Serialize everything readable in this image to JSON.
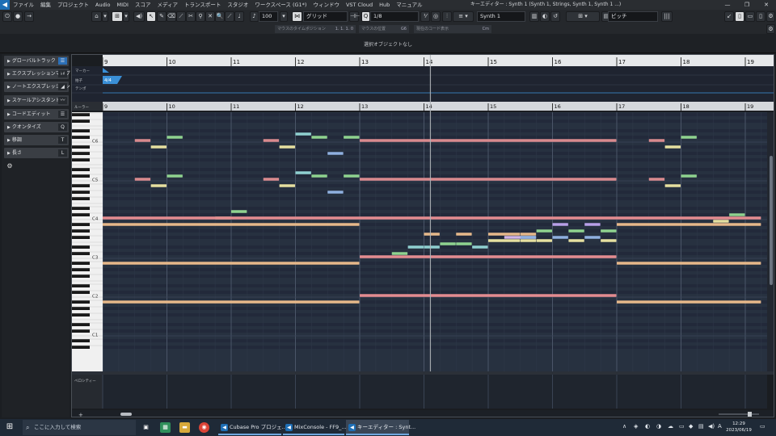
{
  "menubar": {
    "items": [
      "ファイル",
      "編集",
      "プロジェクト",
      "Audio",
      "MIDI",
      "スコア",
      "メディア",
      "トランスポート",
      "スタジオ",
      "ワークスペース (G1*)",
      "ウィンドウ",
      "VST Cloud",
      "Hub",
      "マニュアル"
    ],
    "window_title": "キーエディター : Synth 1 (Synth 1, Strings, Synth 1, Synth 1 ...)",
    "controls": [
      "—",
      "❐",
      "✕"
    ]
  },
  "toolbar": {
    "velocity_value": "100",
    "snap_mode": "グリッド",
    "quantize_value": "1/8",
    "instrument": "Synth 1",
    "note_expression_param": "ピッチ"
  },
  "infoline": {
    "fields": [
      {
        "label": "マウスのタイムポジション",
        "value": "1. 1. 1.  0"
      },
      {
        "label": "マウスの位置",
        "value": "G6"
      },
      {
        "label": "現在のコード表示",
        "value": "Cm"
      }
    ]
  },
  "status": {
    "message": "選択オブジェクトなし"
  },
  "inspector": {
    "sections": [
      {
        "label": "グローバルトラック",
        "icon": "☰"
      },
      {
        "label": "エクスプレッションマップ",
        "icon": "♭♯"
      },
      {
        "label": "ノートエクスプレッション",
        "icon": "◢"
      },
      {
        "label": "スケールアシスタント",
        "icon": "〰"
      },
      {
        "label": "コードエディット",
        "icon": "☰"
      },
      {
        "label": "クオンタイズ",
        "icon": "Q"
      },
      {
        "label": "移調",
        "icon": "T"
      },
      {
        "label": "長さ",
        "icon": "L"
      }
    ]
  },
  "editor": {
    "bars": [
      "9",
      "10",
      "11",
      "12",
      "13",
      "14",
      "15",
      "16",
      "17",
      "18",
      "19"
    ],
    "global_tracks": [
      "マーカー",
      "拍子",
      "テンポ"
    ],
    "ruler_label": "ルーラー",
    "time_signature": "4/4",
    "octave_labels": [
      "C6",
      "C5",
      "C4",
      "C3",
      "C2",
      "C1"
    ],
    "controller_lane_label": "ベロシティー",
    "notes": [
      {
        "bar": 9.5,
        "len": 0.25,
        "pitch": 84,
        "color": "#d98a8e"
      },
      {
        "bar": 9.75,
        "len": 0.25,
        "pitch": 82,
        "color": "#e6e0a0"
      },
      {
        "bar": 10.0,
        "len": 0.25,
        "pitch": 85,
        "color": "#8fd38f"
      },
      {
        "bar": 9.5,
        "len": 0.25,
        "pitch": 72,
        "color": "#d98a8e"
      },
      {
        "bar": 9.75,
        "len": 0.25,
        "pitch": 70,
        "color": "#e6e0a0"
      },
      {
        "bar": 10.0,
        "len": 0.25,
        "pitch": 73,
        "color": "#8fd38f"
      },
      {
        "bar": 11.0,
        "len": 0.25,
        "pitch": 62,
        "color": "#8fd38f"
      },
      {
        "bar": 10.75,
        "len": 0.25,
        "pitch": 60,
        "color": "#e6e0a0"
      },
      {
        "bar": 11.5,
        "len": 0.25,
        "pitch": 84,
        "color": "#d98a8e"
      },
      {
        "bar": 11.75,
        "len": 0.25,
        "pitch": 82,
        "color": "#e6e0a0"
      },
      {
        "bar": 12.0,
        "len": 0.25,
        "pitch": 86,
        "color": "#8fd0d0"
      },
      {
        "bar": 12.25,
        "len": 0.25,
        "pitch": 85,
        "color": "#8fd38f"
      },
      {
        "bar": 12.5,
        "len": 0.25,
        "pitch": 80,
        "color": "#8fb0e0"
      },
      {
        "bar": 12.75,
        "len": 0.25,
        "pitch": 85,
        "color": "#8fd38f"
      },
      {
        "bar": 11.5,
        "len": 0.25,
        "pitch": 72,
        "color": "#d98a8e"
      },
      {
        "bar": 11.75,
        "len": 0.25,
        "pitch": 70,
        "color": "#e6e0a0"
      },
      {
        "bar": 12.0,
        "len": 0.25,
        "pitch": 74,
        "color": "#8fd0d0"
      },
      {
        "bar": 12.25,
        "len": 0.25,
        "pitch": 73,
        "color": "#8fd38f"
      },
      {
        "bar": 12.5,
        "len": 0.25,
        "pitch": 68,
        "color": "#8fb0e0"
      },
      {
        "bar": 12.75,
        "len": 0.25,
        "pitch": 73,
        "color": "#8fd38f"
      },
      {
        "bar": 13.0,
        "len": 4.0,
        "pitch": 84,
        "color": "#d98a8e"
      },
      {
        "bar": 13.0,
        "len": 4.0,
        "pitch": 72,
        "color": "#d98a8e"
      },
      {
        "bar": 17.5,
        "len": 0.25,
        "pitch": 84,
        "color": "#d98a8e"
      },
      {
        "bar": 17.75,
        "len": 0.25,
        "pitch": 82,
        "color": "#e6e0a0"
      },
      {
        "bar": 18.0,
        "len": 0.25,
        "pitch": 85,
        "color": "#8fd38f"
      },
      {
        "bar": 17.5,
        "len": 0.25,
        "pitch": 72,
        "color": "#d98a8e"
      },
      {
        "bar": 17.75,
        "len": 0.25,
        "pitch": 70,
        "color": "#e6e0a0"
      },
      {
        "bar": 18.0,
        "len": 0.25,
        "pitch": 73,
        "color": "#8fd38f"
      },
      {
        "bar": 9.0,
        "len": 10.25,
        "pitch": 60,
        "color": "#e38c90"
      },
      {
        "bar": 9.0,
        "len": 4.0,
        "pitch": 58,
        "color": "#e6b88a"
      },
      {
        "bar": 17.0,
        "len": 2.25,
        "pitch": 58,
        "color": "#e6b88a"
      },
      {
        "bar": 9.0,
        "len": 4.0,
        "pitch": 46,
        "color": "#e6b88a"
      },
      {
        "bar": 17.0,
        "len": 2.25,
        "pitch": 46,
        "color": "#e6b88a"
      },
      {
        "bar": 9.0,
        "len": 4.0,
        "pitch": 34,
        "color": "#e6b88a"
      },
      {
        "bar": 17.0,
        "len": 2.25,
        "pitch": 34,
        "color": "#e6b88a"
      },
      {
        "bar": 13.0,
        "len": 4.0,
        "pitch": 48,
        "color": "#e38c90"
      },
      {
        "bar": 13.0,
        "len": 4.0,
        "pitch": 36,
        "color": "#e38c90"
      },
      {
        "bar": 13.5,
        "len": 0.25,
        "pitch": 49,
        "color": "#8fd38f"
      },
      {
        "bar": 13.75,
        "len": 0.25,
        "pitch": 51,
        "color": "#8fd0d0"
      },
      {
        "bar": 14.0,
        "len": 0.25,
        "pitch": 55,
        "color": "#e6b88a"
      },
      {
        "bar": 14.0,
        "len": 0.25,
        "pitch": 51,
        "color": "#8fd0d0"
      },
      {
        "bar": 14.25,
        "len": 0.25,
        "pitch": 52,
        "color": "#8fd38f"
      },
      {
        "bar": 14.5,
        "len": 0.25,
        "pitch": 55,
        "color": "#e6b88a"
      },
      {
        "bar": 14.5,
        "len": 0.25,
        "pitch": 52,
        "color": "#8fd38f"
      },
      {
        "bar": 14.75,
        "len": 0.25,
        "pitch": 51,
        "color": "#8fd0d0"
      },
      {
        "bar": 15.0,
        "len": 0.5,
        "pitch": 55,
        "color": "#e6b88a"
      },
      {
        "bar": 15.0,
        "len": 0.5,
        "pitch": 53,
        "color": "#e6e0a0"
      },
      {
        "bar": 15.25,
        "len": 0.5,
        "pitch": 54,
        "color": "#d0b4e8"
      },
      {
        "bar": 15.5,
        "len": 0.25,
        "pitch": 55,
        "color": "#e6b88a"
      },
      {
        "bar": 15.5,
        "len": 0.25,
        "pitch": 53,
        "color": "#e6e0a0"
      },
      {
        "bar": 15.5,
        "len": 0.25,
        "pitch": 54,
        "color": "#8fb0e0"
      },
      {
        "bar": 15.75,
        "len": 0.25,
        "pitch": 56,
        "color": "#8fd38f"
      },
      {
        "bar": 15.75,
        "len": 0.25,
        "pitch": 53,
        "color": "#e6e0a0"
      },
      {
        "bar": 16.0,
        "len": 0.25,
        "pitch": 58,
        "color": "#b8a0e8"
      },
      {
        "bar": 16.0,
        "len": 0.25,
        "pitch": 54,
        "color": "#8fb0e0"
      },
      {
        "bar": 16.25,
        "len": 0.25,
        "pitch": 56,
        "color": "#8fd38f"
      },
      {
        "bar": 16.25,
        "len": 0.25,
        "pitch": 53,
        "color": "#e6e0a0"
      },
      {
        "bar": 16.5,
        "len": 0.25,
        "pitch": 58,
        "color": "#b8a0e8"
      },
      {
        "bar": 16.5,
        "len": 0.25,
        "pitch": 54,
        "color": "#8fb0e0"
      },
      {
        "bar": 16.75,
        "len": 0.25,
        "pitch": 56,
        "color": "#8fd38f"
      },
      {
        "bar": 16.75,
        "len": 0.25,
        "pitch": 53,
        "color": "#e6e0a0"
      },
      {
        "bar": 18.75,
        "len": 0.25,
        "pitch": 61,
        "color": "#8fd38f"
      },
      {
        "bar": 18.5,
        "len": 0.25,
        "pitch": 59,
        "color": "#e6e0a0"
      }
    ],
    "cursor_bar": 14.1,
    "colors": {
      "grid_bg": "#273140",
      "grid_bg_alt": "#22293a",
      "bar_line": "#4a5568",
      "cursor": "#b0b4b8"
    }
  },
  "taskbar": {
    "search_placeholder": "ここに入力して検索",
    "apps": [
      {
        "label": "Cubase Pro プロジェ...",
        "active": false
      },
      {
        "label": "MixConsole - FF9_...",
        "active": false
      },
      {
        "label": "キーエディター : Synt...",
        "active": true
      }
    ],
    "time": "12:29",
    "date": "2023/06/19",
    "ime": "A"
  }
}
